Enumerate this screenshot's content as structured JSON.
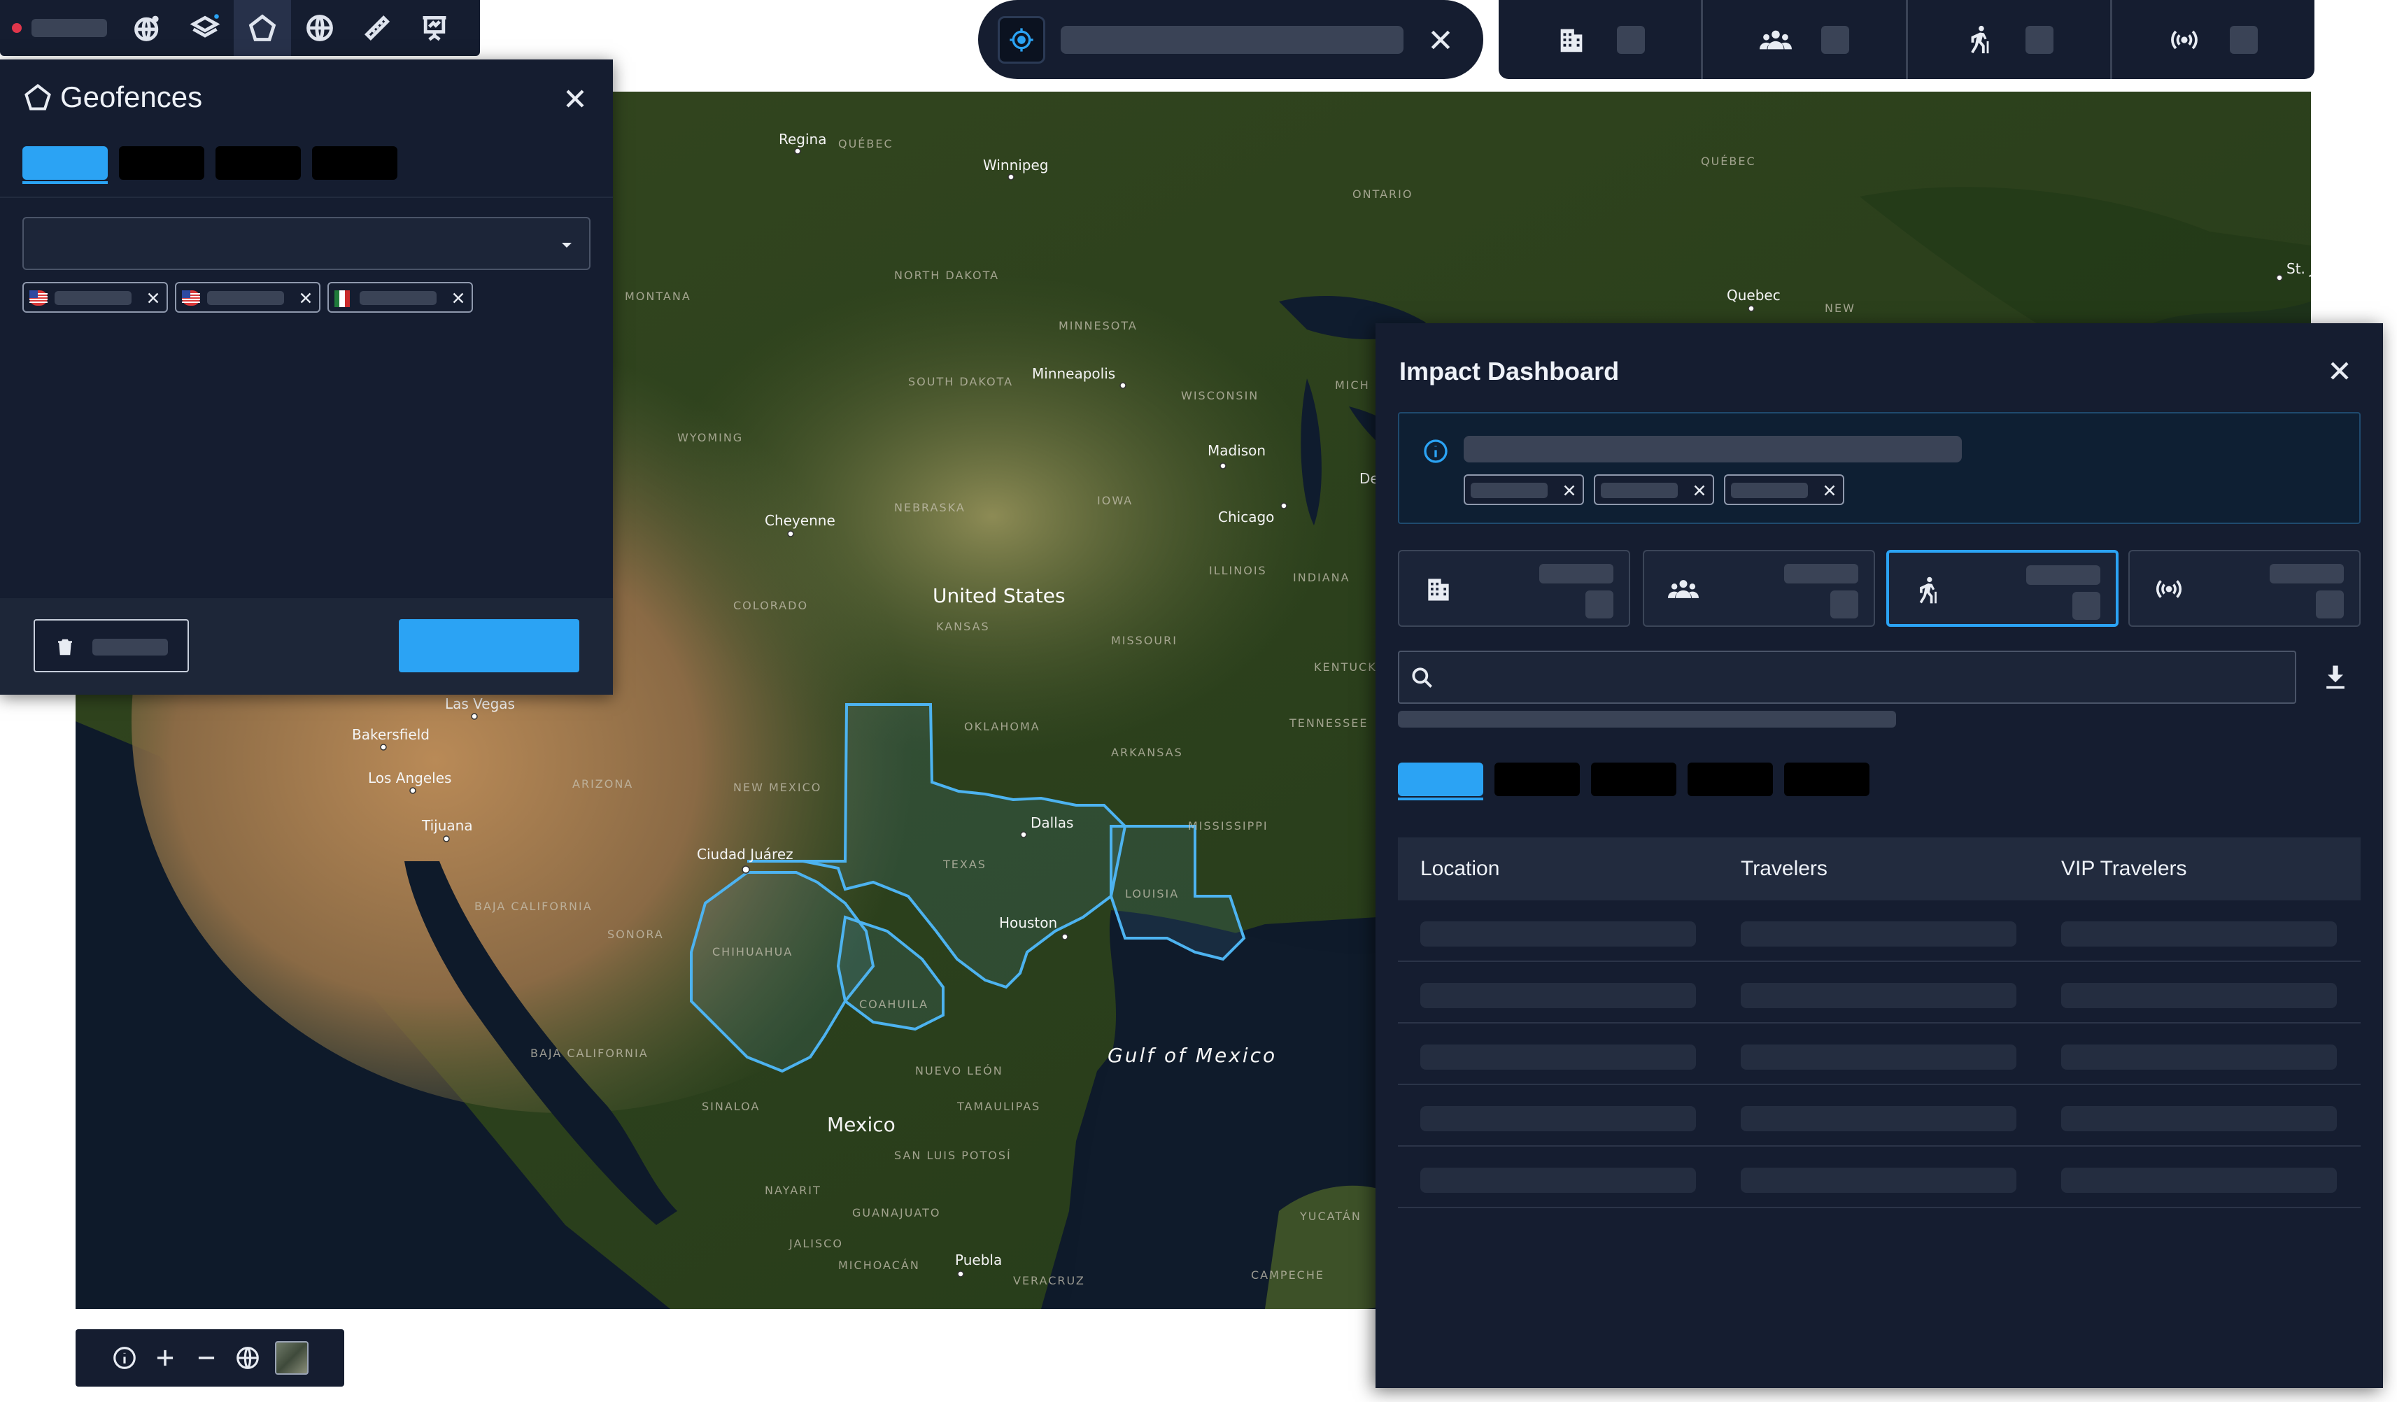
{
  "toolbar": {
    "items": [
      {
        "name": "recording-indicator",
        "icon": "record-dot-icon"
      },
      {
        "name": "globe-pin-tool",
        "icon": "globe-pin-icon"
      },
      {
        "name": "layers-tool",
        "icon": "layers-icon"
      },
      {
        "name": "geofence-tool",
        "icon": "pentagon-icon",
        "selected": true
      },
      {
        "name": "globe-tool",
        "icon": "globe-icon"
      },
      {
        "name": "measure-tool",
        "icon": "ruler-icon"
      },
      {
        "name": "presentation-tool",
        "icon": "presentation-icon"
      }
    ]
  },
  "search": {
    "icon": "target-icon",
    "clear_icon": "close-icon"
  },
  "metrics_bar": {
    "groups": [
      {
        "icon": "building-icon"
      },
      {
        "icon": "people-group-icon"
      },
      {
        "icon": "traveler-icon"
      },
      {
        "icon": "broadcast-icon"
      }
    ]
  },
  "geofences": {
    "title": "Geofences",
    "title_icon": "pentagon-icon",
    "tabs_count": 4,
    "active_tab": 0,
    "tags": [
      {
        "flag": "us-flag-icon"
      },
      {
        "flag": "us-flag-icon"
      },
      {
        "flag": "mexico-flag-icon"
      }
    ],
    "delete_icon": "trash-icon"
  },
  "map": {
    "labels": {
      "regina": "Regina",
      "winnipeg": "Winnipeg",
      "quebec_prov": "QUÉBEC",
      "ontario": "ONTARIO",
      "st_j": "St. J",
      "quebec": "Quebec",
      "north_dakota": "NORTH DAKOTA",
      "minnesota": "MINNESOTA",
      "montana": "MONTANA",
      "south_dakota": "SOUTH DAKOTA",
      "minneapolis": "Minneapolis",
      "wisconsin": "WISCONSIN",
      "michigan": "MICH",
      "new": "NEW",
      "madison": "Madison",
      "wyoming": "WYOMING",
      "iowa": "IOWA",
      "de": "De",
      "cheyenne": "Cheyenne",
      "nebraska": "NEBRASKA",
      "chicago": "Chicago",
      "illinois": "ILLINOIS",
      "indiana": "INDIANA",
      "united_states": "United States",
      "colorado": "COLORADO",
      "kansas": "KANSAS",
      "missouri": "MISSOURI",
      "kentucky": "KENTUCK",
      "las_vegas": "Las Vegas",
      "oklahoma": "OKLAHOMA",
      "tennessee": "TENNESSEE",
      "bakersfield": "Bakersfield",
      "arkansas": "ARKANSAS",
      "los_angeles": "Los Angeles",
      "arizona": "ARIZONA",
      "new_mexico": "NEW MEXICO",
      "tijuana": "Tijuana",
      "dallas": "Dallas",
      "mississippi": "MISSISSIPPI",
      "ciudad_juarez": "Ciudad Juárez",
      "texas": "TEXAS",
      "louisiana": "LOUISIA",
      "baja_california": "BAJA CALIFORNIA",
      "sonora": "SONORA",
      "houston": "Houston",
      "chihuahua": "CHIHUAHUA",
      "coahuila": "COAHUILA",
      "baja_california_sur": "BAJA CALIFORNIA",
      "gulf_of_mexico": "Gulf of Mexico",
      "nuevo_leon": "NUEVO LEÓN",
      "sinaloa": "SINALOA",
      "tamaulipas": "TAMAULIPAS",
      "mexico": "Mexico",
      "san_luis": "SAN LUIS POTOSÍ",
      "nayarit": "NAYARIT",
      "guanajuato": "GUANAJUATO",
      "jalisco": "JALISCO",
      "yucatan": "YUCATÁN",
      "puebla": "Puebla",
      "michoacan": "MICHOACÁN",
      "veracruz": "VERACRUZ",
      "campeche": "CAMPECHE"
    }
  },
  "impact": {
    "title": "Impact Dashboard",
    "info_icon": "info-icon",
    "tiles": [
      {
        "icon": "building-icon"
      },
      {
        "icon": "people-group-icon"
      },
      {
        "icon": "traveler-icon",
        "selected": true
      },
      {
        "icon": "broadcast-icon"
      }
    ],
    "search_icon": "search-icon",
    "download_icon": "download-icon",
    "tabs_count": 5,
    "active_tab": 0,
    "table": {
      "columns": [
        "Location",
        "Travelers",
        "VIP Travelers"
      ],
      "row_count": 5
    }
  },
  "map_controls": {
    "items": [
      "info-icon",
      "zoom-in-icon",
      "zoom-out-icon",
      "globe-icon",
      "satellite-thumbnail-icon"
    ]
  },
  "colors": {
    "panel": "#151d30",
    "accent": "#2ba3f4",
    "geofence_outline": "#4db3f0",
    "record": "#e0364b"
  }
}
